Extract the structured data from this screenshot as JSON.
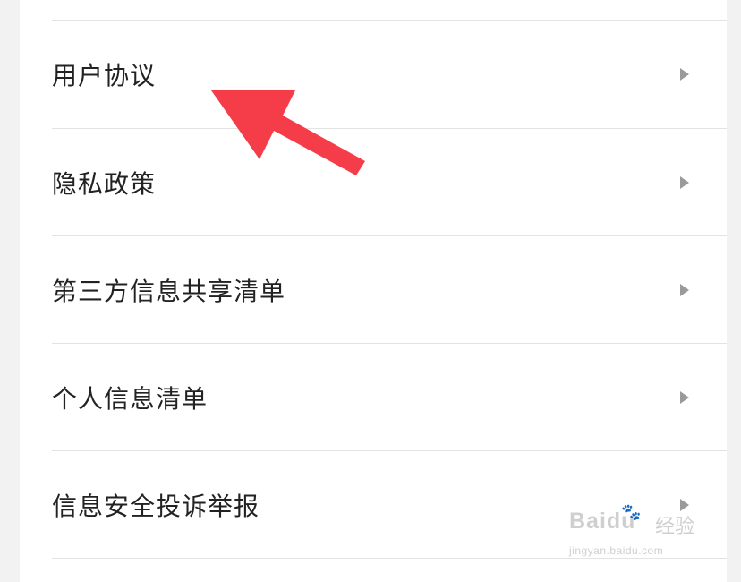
{
  "settings": {
    "items": [
      {
        "label": "用户协议"
      },
      {
        "label": "隐私政策"
      },
      {
        "label": "第三方信息共享清单"
      },
      {
        "label": "个人信息清单"
      },
      {
        "label": "信息安全投诉举报"
      }
    ]
  },
  "annotation": {
    "arrow_color": "#f53d4a",
    "icon": "arrow-pointer-icon"
  },
  "watermark": {
    "brand": "Baidu",
    "suffix": "经验",
    "url": "jingyan.baidu.com",
    "icon": "paw-icon"
  }
}
